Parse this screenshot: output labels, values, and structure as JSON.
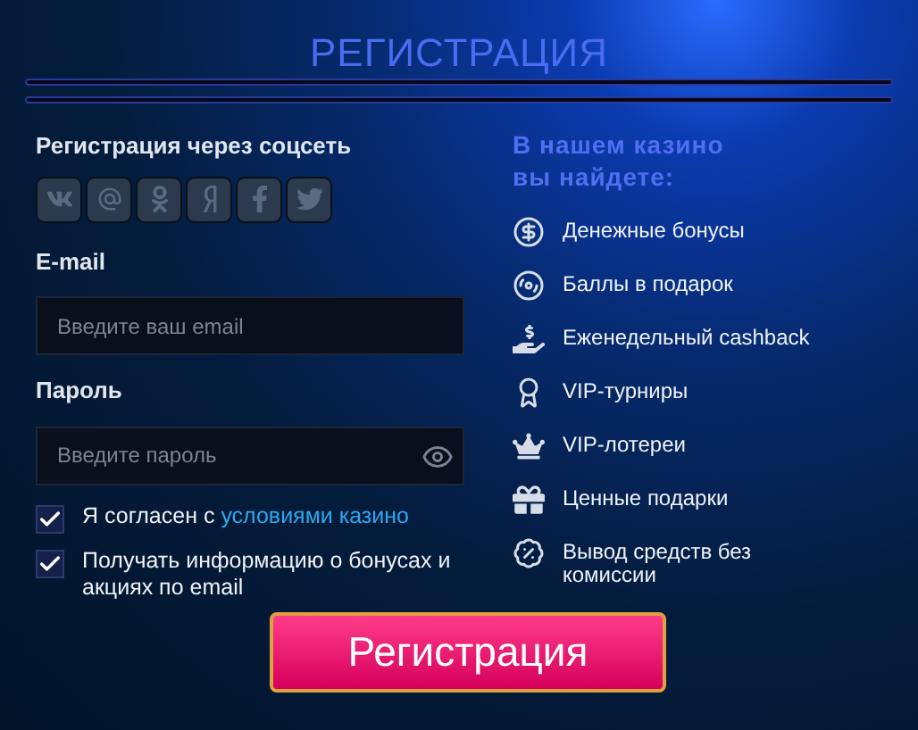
{
  "title": "РЕГИСТРАЦИЯ",
  "social": {
    "label": "Регистрация через соцсеть"
  },
  "email": {
    "label": "E-mail",
    "placeholder": "Введите ваш email"
  },
  "password": {
    "label": "Пароль",
    "placeholder": "Введите пароль"
  },
  "checkboxes": [
    {
      "label": "Я согласен с",
      "link": "условиями казино",
      "checked": true
    },
    {
      "label": "Получать информацию о бонусах и акциях по email",
      "checked": true
    }
  ],
  "features": {
    "heading": "В нашем казино вы найдете:",
    "items": [
      "Денежные бонусы",
      "Баллы в подарок",
      "Еженедельный cashback",
      "VIP-турниры",
      "VIP-лотереи",
      "Ценные подарки",
      "Вывод средств без комиссии"
    ]
  },
  "submit": "Регистрация"
}
